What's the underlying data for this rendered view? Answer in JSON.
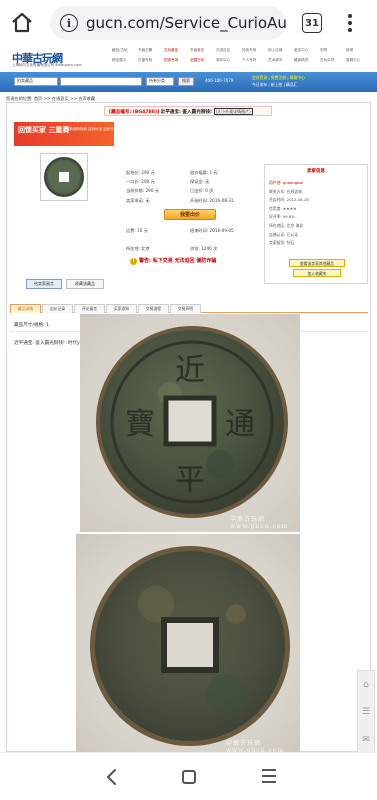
{
  "browser": {
    "url": "gucn.com/Service_CurioAuc",
    "tab_count": "31"
  },
  "site": {
    "logo": "中華古玩網",
    "logo_sub": "上海纳尔文化传播有限公司  www.gucn.com",
    "top_links": [
      "藏品/古玩",
      "书画古籍",
      "古玩鉴定",
      "书画鉴定",
      "交流社区",
      "拍卖专场",
      "网上店铺",
      "鉴定中心",
      "学院",
      "新闻",
      "精品展示",
      "古董专柜",
      "拍卖专场",
      "全国古玩",
      "商务中心",
      "个人专场",
      "艺术超市",
      "藏家精选",
      "古玩杂项",
      "客服中心"
    ],
    "search_select": "拍卖藏品",
    "search_select2": "所有分类",
    "search_go": "搜索",
    "phone": "400-100-7079",
    "login_line1": "会员登录 | 免费注册 | 帮助中心",
    "login_line2": "今日发布 | 新上拍 | 精品汇",
    "breadcrumb": "您现在的位置: 首页 >> 在线竞买 >> 古币收藏"
  },
  "item": {
    "code_label": "[藏品编号:",
    "code_value": "(BG4788)]",
    "title": "近平通宝: 鉴入霸光铜钱!",
    "boxed_note": "(大小外观详情图片)"
  },
  "ad": {
    "main": "回馈买家 三重奏",
    "sub": "送新品购物券 送特价品 送积分"
  },
  "info": {
    "rows": [
      "起拍价: 290 元",
      "加价幅度: 1 元",
      "一口价: 290 元",
      "保证金: 无",
      "当前价格: 290 元",
      "已出价: 0 次",
      "卖家承诺: 无",
      "开始时间: 2016-08-31",
      "运费: 10 元",
      "结束时间: 2016-09-05",
      "所在地: 北京",
      "浏览: 1240 次"
    ],
    "bid_button": "我要出价",
    "warning": "警告: 私下交易  无法追回  谨防诈骗"
  },
  "seller": {
    "title": "卖家信息",
    "rows": [
      "用户名: gudongbai",
      "联系方式: 在线咨询",
      "开店时间: 2012-06-28",
      "信用度: ★★★★",
      "好评率: 99.8%",
      "所在地区: 北京 海淀",
      "店铺认证: 已认证",
      "卖家级别: 钻石",
      "发布数量: 325",
      "客户服务: 在线"
    ],
    "btn1": "查看该卖家其他藏品",
    "btn2": "加入收藏夹"
  },
  "buttons": {
    "message": "给卖家留言",
    "favorite": "收藏该藏品"
  },
  "tabs": [
    "藏品详情",
    "出价记录",
    "评论留言",
    "买家须知",
    "交易流程",
    "交易声明"
  ],
  "spec": "藏品尺寸/规格: 1",
  "description": "近平通宝: 鉴入霸光铜钱!   :时代y993造型:  一三六零二九五五八六六",
  "coin": {
    "char_top": "近",
    "char_right": "通",
    "char_bottom": "平",
    "char_left": "寶"
  },
  "watermark": "中華古玩網 www.gucn.com"
}
